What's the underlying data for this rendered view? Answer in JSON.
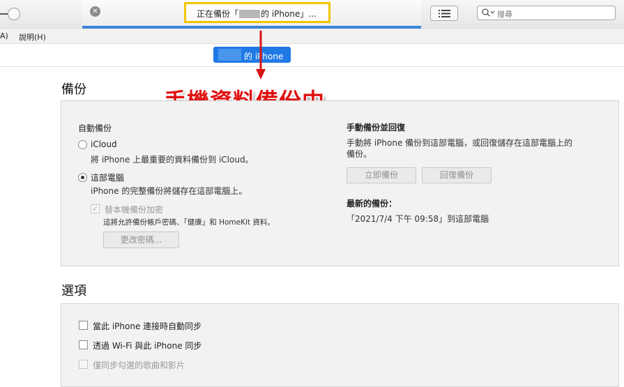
{
  "toolbar": {
    "close_symbol": "✕",
    "status_prefix": "正在備份「",
    "status_suffix": "的 iPhone」...",
    "search_placeholder": "搜尋",
    "progress_fraction": 1.0
  },
  "menu": {
    "item_partial": "A)",
    "help": "說明(H)"
  },
  "device": {
    "name_suffix": "的 iPhone"
  },
  "annotation": {
    "text": "手機資料備份中"
  },
  "backup": {
    "title": "備份",
    "auto": {
      "heading": "自動備份",
      "icloud_label": "iCloud",
      "icloud_desc": "將 iPhone 上最重要的資料備份到 iCloud。",
      "computer_label": "這部電腦",
      "computer_desc": "iPhone 的完整備份將儲存在這部電腦上。",
      "encrypt_label": "替本機備份加密",
      "encrypt_desc": "這將允許備份帳戶密碼、「健康」和 HomeKit 資料。",
      "change_password": "更改密碼..."
    },
    "manual": {
      "heading": "手動備份並回復",
      "desc_line1": "手動將 iPhone 備份到這部電腦，或回復儲存在這部電腦上的",
      "desc_line2": "備份。",
      "backup_now": "立即備份",
      "restore": "回復備份",
      "latest_heading": "最新的備份：",
      "latest_value": "「2021/7/4 下午 09:58」到這部電腦"
    }
  },
  "options": {
    "title": "選項",
    "auto_sync": "當此 iPhone 連接時自動同步",
    "wifi_sync": "透過 Wi-Fi 與此 iPhone 同步",
    "checked_only": "僅同步勾選的歌曲和影片"
  },
  "colors": {
    "accent": "#1f7ae6",
    "highlight_box": "#f2c500",
    "annotation": "#e01111"
  }
}
